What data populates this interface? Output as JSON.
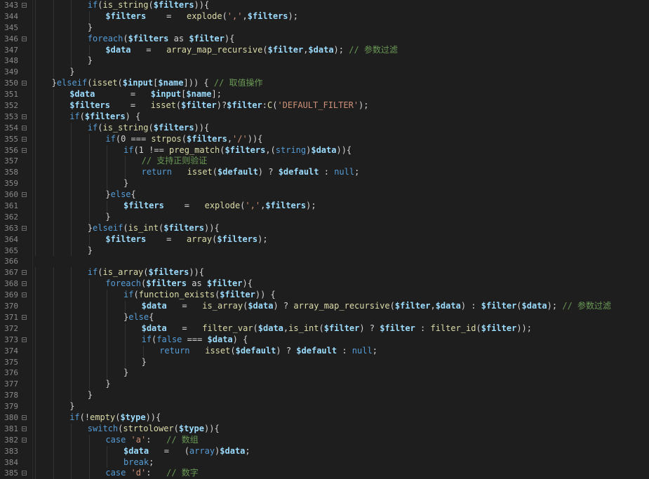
{
  "editor": {
    "language": "php",
    "theme_colors": {
      "background": "#1e1e1e",
      "line_number": "#8a8a8a",
      "default": "#d4d4d4",
      "keyword": "#569cd6",
      "variable": "#9cdcfe",
      "string": "#ce9178",
      "comment": "#6a9955",
      "function": "#dcdcaa"
    },
    "lines": [
      {
        "n": "343",
        "fold": true,
        "indent": 3,
        "tokens": [
          [
            "kw",
            "if"
          ],
          [
            "op",
            "("
          ],
          [
            "fn",
            "is_string"
          ],
          [
            "op",
            "("
          ],
          [
            "var",
            "$filters"
          ],
          [
            "op",
            "))"
          ],
          [
            "op",
            "{"
          ]
        ]
      },
      {
        "n": "344",
        "fold": false,
        "indent": 4,
        "tokens": [
          [
            "var",
            "$filters"
          ],
          [
            "op",
            "    =   "
          ],
          [
            "fn",
            "explode"
          ],
          [
            "op",
            "("
          ],
          [
            "str",
            "','"
          ],
          [
            "op",
            ","
          ],
          [
            "var",
            "$filters"
          ],
          [
            "op",
            ");"
          ]
        ]
      },
      {
        "n": "345",
        "fold": false,
        "indent": 3,
        "tokens": [
          [
            "op",
            "}"
          ]
        ]
      },
      {
        "n": "346",
        "fold": true,
        "indent": 3,
        "tokens": [
          [
            "kw",
            "foreach"
          ],
          [
            "op",
            "("
          ],
          [
            "var",
            "$filters"
          ],
          [
            "op",
            " as "
          ],
          [
            "var",
            "$filter"
          ],
          [
            "op",
            "){"
          ]
        ]
      },
      {
        "n": "347",
        "fold": false,
        "indent": 4,
        "tokens": [
          [
            "var",
            "$data"
          ],
          [
            "op",
            "   =   "
          ],
          [
            "fn",
            "array_map_recursive"
          ],
          [
            "op",
            "("
          ],
          [
            "var",
            "$filter"
          ],
          [
            "op",
            ","
          ],
          [
            "var",
            "$data"
          ],
          [
            "op",
            "); "
          ],
          [
            "com",
            "// 参数过滤"
          ]
        ]
      },
      {
        "n": "348",
        "fold": false,
        "indent": 3,
        "tokens": [
          [
            "op",
            "}"
          ]
        ]
      },
      {
        "n": "349",
        "fold": false,
        "indent": 2,
        "tokens": [
          [
            "op",
            "}"
          ]
        ]
      },
      {
        "n": "350",
        "fold": true,
        "indent": 1,
        "tokens": [
          [
            "op",
            "}"
          ],
          [
            "kw",
            "elseif"
          ],
          [
            "op",
            "("
          ],
          [
            "fn",
            "isset"
          ],
          [
            "op",
            "("
          ],
          [
            "var",
            "$input"
          ],
          [
            "op",
            "["
          ],
          [
            "var",
            "$name"
          ],
          [
            "op",
            "])) { "
          ],
          [
            "com",
            "// 取值操作"
          ]
        ]
      },
      {
        "n": "351",
        "fold": false,
        "indent": 2,
        "tokens": [
          [
            "var",
            "$data"
          ],
          [
            "op",
            "       =   "
          ],
          [
            "var",
            "$input"
          ],
          [
            "op",
            "["
          ],
          [
            "var",
            "$name"
          ],
          [
            "op",
            "];"
          ]
        ]
      },
      {
        "n": "352",
        "fold": false,
        "indent": 2,
        "tokens": [
          [
            "var",
            "$filters"
          ],
          [
            "op",
            "    =   "
          ],
          [
            "fn",
            "isset"
          ],
          [
            "op",
            "("
          ],
          [
            "var",
            "$filter"
          ],
          [
            "op",
            ")?"
          ],
          [
            "var",
            "$filter"
          ],
          [
            "op",
            ":"
          ],
          [
            "fn",
            "C"
          ],
          [
            "op",
            "("
          ],
          [
            "str",
            "'DEFAULT_FILTER'"
          ],
          [
            "op",
            ");"
          ]
        ]
      },
      {
        "n": "353",
        "fold": true,
        "indent": 2,
        "tokens": [
          [
            "kw",
            "if"
          ],
          [
            "op",
            "("
          ],
          [
            "var",
            "$filters"
          ],
          [
            "op",
            ") {"
          ]
        ]
      },
      {
        "n": "354",
        "fold": true,
        "indent": 3,
        "tokens": [
          [
            "kw",
            "if"
          ],
          [
            "op",
            "("
          ],
          [
            "fn",
            "is_string"
          ],
          [
            "op",
            "("
          ],
          [
            "var",
            "$filters"
          ],
          [
            "op",
            "))"
          ],
          [
            "op",
            "{"
          ]
        ]
      },
      {
        "n": "355",
        "fold": true,
        "indent": 4,
        "tokens": [
          [
            "kw",
            "if"
          ],
          [
            "op",
            "(0 === "
          ],
          [
            "fn",
            "strpos"
          ],
          [
            "op",
            "("
          ],
          [
            "var",
            "$filters"
          ],
          [
            "op",
            ","
          ],
          [
            "str",
            "'/'"
          ],
          [
            "op",
            ")){"
          ]
        ]
      },
      {
        "n": "356",
        "fold": true,
        "indent": 5,
        "tokens": [
          [
            "kw",
            "if"
          ],
          [
            "op",
            "(1 !== "
          ],
          [
            "fn",
            "preg_match"
          ],
          [
            "op",
            "("
          ],
          [
            "var",
            "$filters"
          ],
          [
            "op",
            ",("
          ],
          [
            "type",
            "string"
          ],
          [
            "op",
            ")"
          ],
          [
            "var",
            "$data"
          ],
          [
            "op",
            ")){"
          ]
        ]
      },
      {
        "n": "357",
        "fold": false,
        "indent": 6,
        "tokens": [
          [
            "com",
            "// 支持正则验证"
          ]
        ]
      },
      {
        "n": "358",
        "fold": false,
        "indent": 6,
        "tokens": [
          [
            "kw",
            "return"
          ],
          [
            "op",
            "   "
          ],
          [
            "fn",
            "isset"
          ],
          [
            "op",
            "("
          ],
          [
            "var",
            "$default"
          ],
          [
            "op",
            ") ? "
          ],
          [
            "var",
            "$default"
          ],
          [
            "op",
            " : "
          ],
          [
            "null",
            "null"
          ],
          [
            "op",
            ";"
          ]
        ]
      },
      {
        "n": "359",
        "fold": false,
        "indent": 5,
        "tokens": [
          [
            "op",
            "}"
          ]
        ]
      },
      {
        "n": "360",
        "fold": true,
        "indent": 4,
        "tokens": [
          [
            "op",
            "}"
          ],
          [
            "kw",
            "else"
          ],
          [
            "op",
            "{"
          ]
        ]
      },
      {
        "n": "361",
        "fold": false,
        "indent": 5,
        "tokens": [
          [
            "var",
            "$filters"
          ],
          [
            "op",
            "    =   "
          ],
          [
            "fn",
            "explode"
          ],
          [
            "op",
            "("
          ],
          [
            "str",
            "','"
          ],
          [
            "op",
            ","
          ],
          [
            "var",
            "$filters"
          ],
          [
            "op",
            ");"
          ]
        ]
      },
      {
        "n": "362",
        "fold": false,
        "indent": 4,
        "tokens": [
          [
            "op",
            "}"
          ]
        ]
      },
      {
        "n": "363",
        "fold": true,
        "indent": 3,
        "tokens": [
          [
            "op",
            "}"
          ],
          [
            "kw",
            "elseif"
          ],
          [
            "op",
            "("
          ],
          [
            "fn",
            "is_int"
          ],
          [
            "op",
            "("
          ],
          [
            "var",
            "$filters"
          ],
          [
            "op",
            "))"
          ],
          [
            "op",
            "{"
          ]
        ]
      },
      {
        "n": "364",
        "fold": false,
        "indent": 4,
        "tokens": [
          [
            "var",
            "$filters"
          ],
          [
            "op",
            "    =   "
          ],
          [
            "fn",
            "array"
          ],
          [
            "op",
            "("
          ],
          [
            "var",
            "$filters"
          ],
          [
            "op",
            ");"
          ]
        ]
      },
      {
        "n": "365",
        "fold": false,
        "indent": 3,
        "tokens": [
          [
            "op",
            "}"
          ]
        ]
      },
      {
        "n": "366",
        "fold": false,
        "indent": 0,
        "tokens": []
      },
      {
        "n": "367",
        "fold": true,
        "indent": 3,
        "tokens": [
          [
            "kw",
            "if"
          ],
          [
            "op",
            "("
          ],
          [
            "fn",
            "is_array"
          ],
          [
            "op",
            "("
          ],
          [
            "var",
            "$filters"
          ],
          [
            "op",
            "))"
          ],
          [
            "op",
            "{"
          ]
        ]
      },
      {
        "n": "368",
        "fold": true,
        "indent": 4,
        "tokens": [
          [
            "kw",
            "foreach"
          ],
          [
            "op",
            "("
          ],
          [
            "var",
            "$filters"
          ],
          [
            "op",
            " as "
          ],
          [
            "var",
            "$filter"
          ],
          [
            "op",
            "){"
          ]
        ]
      },
      {
        "n": "369",
        "fold": true,
        "indent": 5,
        "tokens": [
          [
            "kw",
            "if"
          ],
          [
            "op",
            "("
          ],
          [
            "fn",
            "function_exists"
          ],
          [
            "op",
            "("
          ],
          [
            "var",
            "$filter"
          ],
          [
            "op",
            ")) {"
          ]
        ]
      },
      {
        "n": "370",
        "fold": false,
        "indent": 6,
        "tokens": [
          [
            "var",
            "$data"
          ],
          [
            "op",
            "   =   "
          ],
          [
            "fn",
            "is_array"
          ],
          [
            "op",
            "("
          ],
          [
            "var",
            "$data"
          ],
          [
            "op",
            ") ? "
          ],
          [
            "fn",
            "array_map_recursive"
          ],
          [
            "op",
            "("
          ],
          [
            "var",
            "$filter"
          ],
          [
            "op",
            ","
          ],
          [
            "var",
            "$data"
          ],
          [
            "op",
            ") : "
          ],
          [
            "var",
            "$filter"
          ],
          [
            "op",
            "("
          ],
          [
            "var",
            "$data"
          ],
          [
            "op",
            "); "
          ],
          [
            "com",
            "// 参数过滤"
          ]
        ]
      },
      {
        "n": "371",
        "fold": true,
        "indent": 5,
        "tokens": [
          [
            "op",
            "}"
          ],
          [
            "kw",
            "else"
          ],
          [
            "op",
            "{"
          ]
        ]
      },
      {
        "n": "372",
        "fold": false,
        "indent": 6,
        "tokens": [
          [
            "var",
            "$data"
          ],
          [
            "op",
            "   =   "
          ],
          [
            "fn",
            "filter_var"
          ],
          [
            "op",
            "("
          ],
          [
            "var",
            "$data"
          ],
          [
            "op",
            ","
          ],
          [
            "fn",
            "is_int"
          ],
          [
            "op",
            "("
          ],
          [
            "var",
            "$filter"
          ],
          [
            "op",
            ") ? "
          ],
          [
            "var",
            "$filter"
          ],
          [
            "op",
            " : "
          ],
          [
            "fn",
            "filter_id"
          ],
          [
            "op",
            "("
          ],
          [
            "var",
            "$filter"
          ],
          [
            "op",
            "));"
          ]
        ]
      },
      {
        "n": "373",
        "fold": true,
        "indent": 6,
        "tokens": [
          [
            "kw",
            "if"
          ],
          [
            "op",
            "("
          ],
          [
            "bool",
            "false"
          ],
          [
            "op",
            " === "
          ],
          [
            "var",
            "$data"
          ],
          [
            "op",
            ") {"
          ]
        ]
      },
      {
        "n": "374",
        "fold": false,
        "indent": 7,
        "tokens": [
          [
            "kw",
            "return"
          ],
          [
            "op",
            "   "
          ],
          [
            "fn",
            "isset"
          ],
          [
            "op",
            "("
          ],
          [
            "var",
            "$default"
          ],
          [
            "op",
            ") ? "
          ],
          [
            "var",
            "$default"
          ],
          [
            "op",
            " : "
          ],
          [
            "null",
            "null"
          ],
          [
            "op",
            ";"
          ]
        ]
      },
      {
        "n": "375",
        "fold": false,
        "indent": 6,
        "tokens": [
          [
            "op",
            "}"
          ]
        ]
      },
      {
        "n": "376",
        "fold": false,
        "indent": 5,
        "tokens": [
          [
            "op",
            "}"
          ]
        ]
      },
      {
        "n": "377",
        "fold": false,
        "indent": 4,
        "tokens": [
          [
            "op",
            "}"
          ]
        ]
      },
      {
        "n": "378",
        "fold": false,
        "indent": 3,
        "tokens": [
          [
            "op",
            "}"
          ]
        ]
      },
      {
        "n": "379",
        "fold": false,
        "indent": 2,
        "tokens": [
          [
            "op",
            "}"
          ]
        ]
      },
      {
        "n": "380",
        "fold": true,
        "indent": 2,
        "tokens": [
          [
            "kw",
            "if"
          ],
          [
            "op",
            "(!"
          ],
          [
            "fn",
            "empty"
          ],
          [
            "op",
            "("
          ],
          [
            "var",
            "$type"
          ],
          [
            "op",
            "))"
          ],
          [
            "op",
            "{"
          ]
        ]
      },
      {
        "n": "381",
        "fold": true,
        "indent": 3,
        "tokens": [
          [
            "kw",
            "switch"
          ],
          [
            "op",
            "("
          ],
          [
            "fn",
            "strtolower"
          ],
          [
            "op",
            "("
          ],
          [
            "var",
            "$type"
          ],
          [
            "op",
            "))"
          ],
          [
            "op",
            "{"
          ]
        ]
      },
      {
        "n": "382",
        "fold": true,
        "indent": 4,
        "tokens": [
          [
            "kw",
            "case"
          ],
          [
            "op",
            " "
          ],
          [
            "str",
            "'a'"
          ],
          [
            "op",
            ":   "
          ],
          [
            "com",
            "// 数组"
          ]
        ]
      },
      {
        "n": "383",
        "fold": false,
        "indent": 5,
        "tokens": [
          [
            "var",
            "$data"
          ],
          [
            "op",
            "   =   ("
          ],
          [
            "type",
            "array"
          ],
          [
            "op",
            ")"
          ],
          [
            "var",
            "$data"
          ],
          [
            "op",
            ";"
          ]
        ]
      },
      {
        "n": "384",
        "fold": false,
        "indent": 5,
        "tokens": [
          [
            "kw",
            "break"
          ],
          [
            "op",
            ";"
          ]
        ]
      },
      {
        "n": "385",
        "fold": true,
        "indent": 4,
        "tokens": [
          [
            "kw",
            "case"
          ],
          [
            "op",
            " "
          ],
          [
            "str",
            "'d'"
          ],
          [
            "op",
            ":   "
          ],
          [
            "com",
            "// 数字"
          ]
        ]
      }
    ]
  }
}
